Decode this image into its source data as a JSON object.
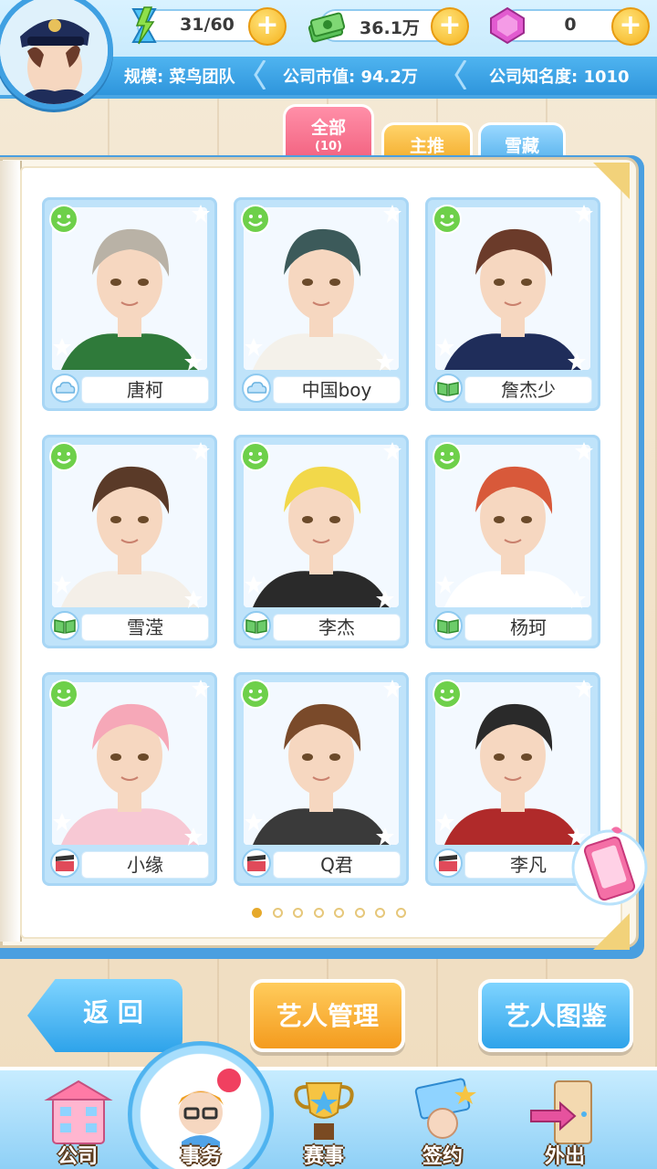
{
  "resources": {
    "stamina": "31/60",
    "money": "36.1万",
    "gems": "0"
  },
  "company": {
    "scale": "规模: 菜鸟团队",
    "market_value": "公司市值: 94.2万",
    "fame": "公司知名度: 1010"
  },
  "tabs": [
    {
      "label": "全部",
      "count": "(10)"
    },
    {
      "label": "主推"
    },
    {
      "label": "雪藏"
    }
  ],
  "artists": [
    {
      "name": "唐柯",
      "type": "cloud"
    },
    {
      "name": "中国boy",
      "type": "cloud"
    },
    {
      "name": "詹杰少",
      "type": "book"
    },
    {
      "name": "雪滢",
      "type": "book"
    },
    {
      "name": "李杰",
      "type": "book"
    },
    {
      "name": "杨珂",
      "type": "book"
    },
    {
      "name": "小缘",
      "type": "film"
    },
    {
      "name": "Q君",
      "type": "film"
    },
    {
      "name": "李凡",
      "type": "film"
    }
  ],
  "pagination": {
    "pages": 8,
    "current": 1
  },
  "buttons": {
    "back": "返 回",
    "manage": "艺人管理",
    "album": "艺人图鉴"
  },
  "nav": [
    {
      "label": "公司"
    },
    {
      "label": "事务",
      "active": true
    },
    {
      "label": "赛事"
    },
    {
      "label": "签约"
    },
    {
      "label": "外出"
    }
  ],
  "colors": {
    "accent_blue": "#3fa0e2",
    "tab_all": "#f2607e",
    "tab_main": "#f4ac2b",
    "button_orange": "#f49b1e"
  }
}
